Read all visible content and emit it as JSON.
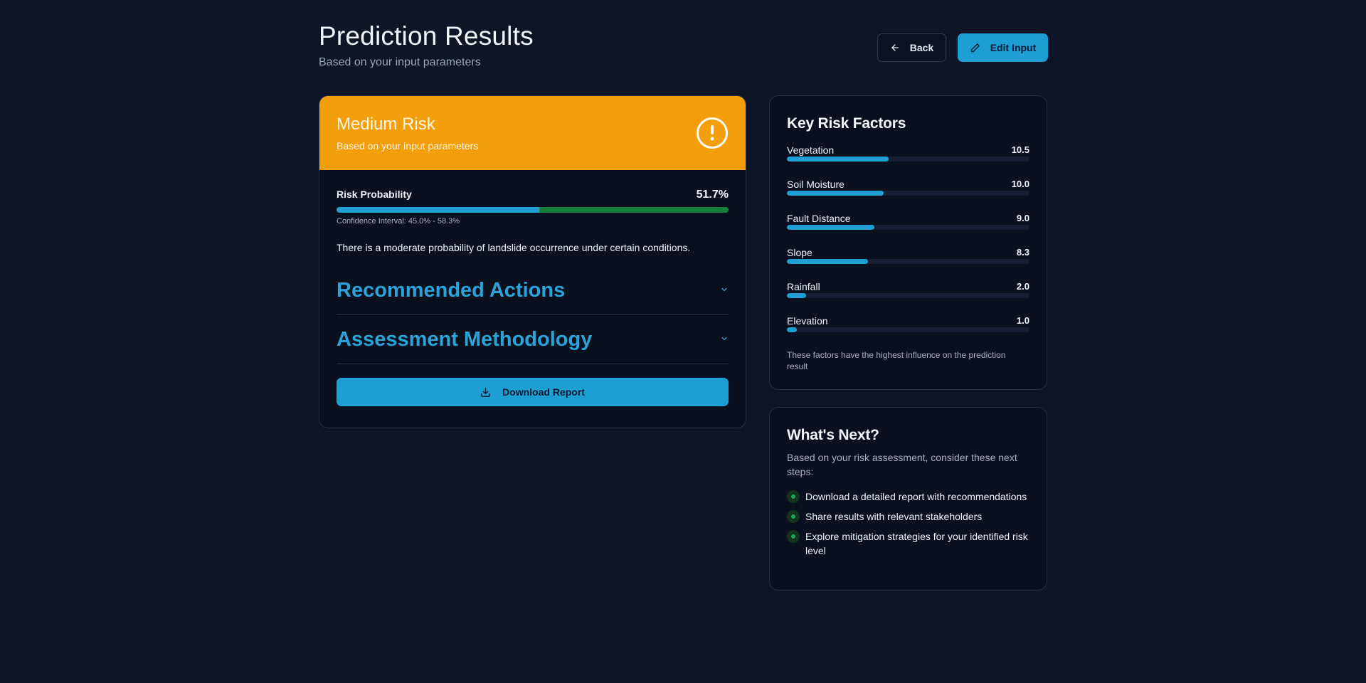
{
  "header": {
    "title": "Prediction Results",
    "subtitle": "Based on your input parameters",
    "back_label": "Back",
    "edit_label": "Edit Input"
  },
  "risk": {
    "level": "Medium Risk",
    "subtitle": "Based on your input parameters",
    "probability_label": "Risk Probability",
    "probability_value": "51.7%",
    "probability_fraction": 0.517,
    "confidence": "Confidence Interval: 45.0% - 58.3%",
    "description": "There is a moderate probability of landslide occurrence under certain conditions.",
    "sections": [
      "Recommended Actions",
      "Assessment Methodology"
    ],
    "download_label": "Download Report",
    "color": "#f59e0b"
  },
  "factors": {
    "title": "Key Risk Factors",
    "items": [
      {
        "name": "Vegetation",
        "value": "10.5",
        "fill": 0.42
      },
      {
        "name": "Soil Moisture",
        "value": "10.0",
        "fill": 0.4
      },
      {
        "name": "Fault Distance",
        "value": "9.0",
        "fill": 0.36
      },
      {
        "name": "Slope",
        "value": "8.3",
        "fill": 0.335
      },
      {
        "name": "Rainfall",
        "value": "2.0",
        "fill": 0.08
      },
      {
        "name": "Elevation",
        "value": "1.0",
        "fill": 0.04
      }
    ],
    "note": "These factors have the highest influence on the prediction result"
  },
  "next": {
    "title": "What's Next?",
    "subtitle": "Based on your risk assessment, consider these next steps:",
    "items": [
      "Download a detailed report with recommendations",
      "Share results with relevant stakeholders",
      "Explore mitigation strategies for your identified risk level"
    ]
  },
  "colors": {
    "accent": "#1e9fd4",
    "success": "#15803d",
    "background": "#0d1526"
  }
}
